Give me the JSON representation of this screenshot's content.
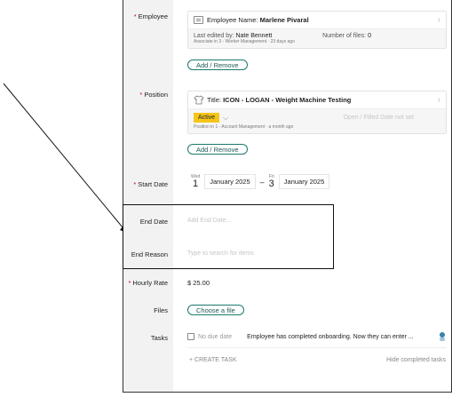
{
  "employee": {
    "label": "Employee",
    "name_prefix": "Employee Name:",
    "name": "Marlene Pivaral",
    "last_edited_prefix": "Last edited by:",
    "last_edited_by": "Nate Bennett",
    "files_prefix": "Number of files:",
    "files_count": "0",
    "meta": "Associate in 3 - Worker Management · 23 days ago",
    "add_remove": "Add / Remove"
  },
  "position": {
    "label": "Position",
    "title_prefix": "Title:",
    "title": "ICON - LOGAN - Weight Machine Testing",
    "status": "Active",
    "open_filled": "Open / Filled Date not set",
    "meta": "Position in 1 - Account Management · a month ago",
    "add_remove": "Add / Remove"
  },
  "start_date": {
    "label": "Start Date",
    "from_weekday": "Wed",
    "from_day": "1",
    "from_month": "January 2025",
    "separator": "–",
    "to_weekday": "Fri",
    "to_day": "3",
    "to_month": "January 2025"
  },
  "end_date": {
    "label": "End Date",
    "placeholder": "Add End Date..."
  },
  "end_reason": {
    "label": "End Reason",
    "placeholder": "Type to search for items"
  },
  "hourly_rate": {
    "label": "Hourly Rate",
    "value": "$ 25.00"
  },
  "files": {
    "label": "Files",
    "button": "Choose a file"
  },
  "tasks": {
    "label": "Tasks",
    "due": "No due date",
    "description": "Employee has completed onboarding. Now they can enter ...",
    "create": "+ CREATE TASK",
    "hide_completed": "Hide completed tasks"
  },
  "colors": {
    "accent": "#1b7a6e",
    "required": "#d0021b",
    "active_badge": "#f5c518"
  }
}
